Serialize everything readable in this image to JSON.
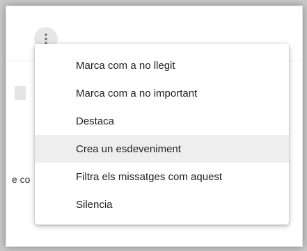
{
  "background": {
    "partial_text": "e co"
  },
  "toolbar": {
    "more_icon": "more-vert-icon"
  },
  "menu": {
    "highlighted_index": 3,
    "items": [
      {
        "label": "Marca com a no llegit"
      },
      {
        "label": "Marca com a no important"
      },
      {
        "label": "Destaca"
      },
      {
        "label": "Crea un esdeveniment"
      },
      {
        "label": "Filtra els missatges com aquest"
      },
      {
        "label": "Silencia"
      }
    ]
  },
  "colors": {
    "highlight": "#eeeeee",
    "button_bg": "#e7e7e7",
    "text": "#202124"
  }
}
